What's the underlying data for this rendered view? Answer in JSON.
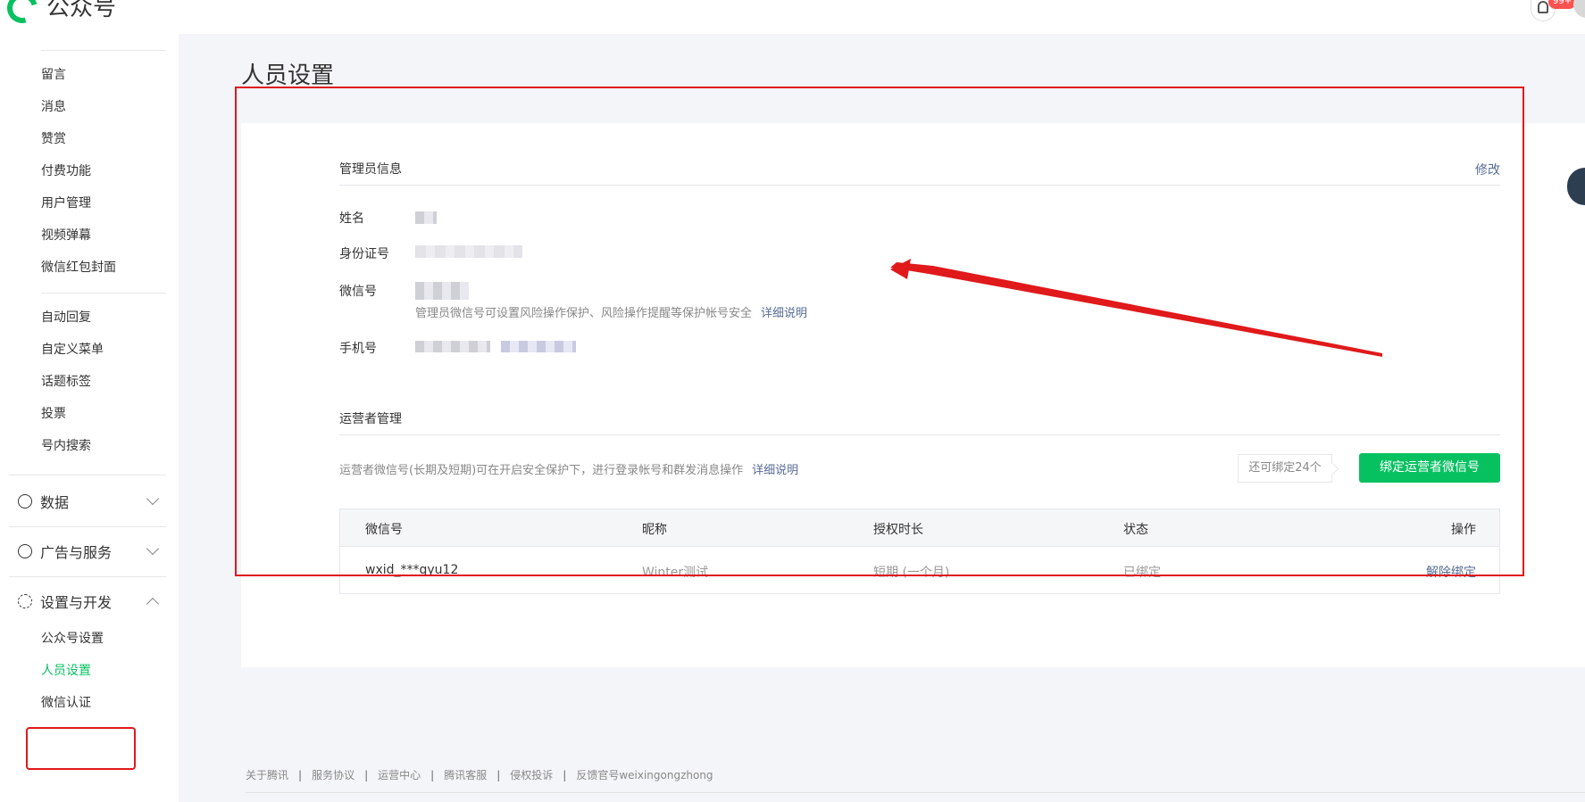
{
  "header": {
    "brand": "公众号",
    "notification_badge": "99+"
  },
  "sidebar": {
    "items_a": [
      "留言",
      "消息",
      "赞赏",
      "付费功能",
      "用户管理",
      "视频弹幕",
      "微信红包封面"
    ],
    "items_b": [
      "自动回复",
      "自定义菜单",
      "话题标签",
      "投票",
      "号内搜索"
    ],
    "groups": [
      {
        "label": "数据",
        "icon": "chart-icon",
        "expanded": false
      },
      {
        "label": "广告与服务",
        "icon": "compass-icon",
        "expanded": false
      },
      {
        "label": "设置与开发",
        "icon": "gear-icon",
        "expanded": true
      }
    ],
    "settings_items": [
      "公众号设置",
      "人员设置",
      "微信认证"
    ],
    "active": "人员设置"
  },
  "main": {
    "title": "人员设置",
    "admin": {
      "section_title": "管理员信息",
      "modify_label": "修改",
      "name_label": "姓名",
      "id_label": "身份证号",
      "wechat_label": "微信号",
      "wechat_tip": "管理员微信号可设置风险操作保护、风险操作提醒等保护帐号安全",
      "detail_link": "详细说明",
      "phone_label": "手机号"
    },
    "operators": {
      "section_title": "运营者管理",
      "tip": "运营者微信号(长期及短期)可在开启安全保护下，进行登录帐号和群发消息操作",
      "detail_link": "详细说明",
      "quota": "还可绑定24个",
      "bind_button": "绑定运营者微信号",
      "columns": [
        "微信号",
        "昵称",
        "授权时长",
        "状态",
        "操作"
      ],
      "rows": [
        {
          "wechat_id": "wxid_***gyu12",
          "nickname": "Winter测试",
          "duration": "短期 (一个月)",
          "status": "已绑定",
          "action": "解除绑定"
        }
      ]
    }
  },
  "footer": {
    "links": [
      "关于腾讯",
      "服务协议",
      "运营中心",
      "腾讯客服",
      "侵权投诉",
      "反馈官号weixingongzhong"
    ]
  },
  "colors": {
    "accent": "#07c160",
    "link": "#576b95",
    "annotation": "#e0191b"
  }
}
